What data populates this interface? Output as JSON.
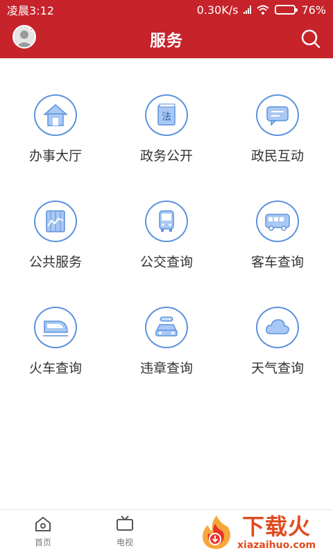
{
  "status_bar": {
    "time": "凌晨3:12",
    "network_speed": "0.30K/s",
    "battery": "76%",
    "battery_level": 0.76
  },
  "header": {
    "title": "服务"
  },
  "services": [
    {
      "label": "办事大厅",
      "icon": "house-icon"
    },
    {
      "label": "政务公开",
      "icon": "law-book-icon"
    },
    {
      "label": "政民互动",
      "icon": "chat-bubble-icon"
    },
    {
      "label": "公共服务",
      "icon": "chart-board-icon"
    },
    {
      "label": "公交查询",
      "icon": "bus-front-icon"
    },
    {
      "label": "客车查询",
      "icon": "coach-bus-icon"
    },
    {
      "label": "火车查询",
      "icon": "train-icon"
    },
    {
      "label": "违章查询",
      "icon": "car-violation-icon"
    },
    {
      "label": "天气查询",
      "icon": "cloud-icon"
    }
  ],
  "law_glyph": "法",
  "bottom_nav": [
    {
      "label": "首页",
      "icon": "home-icon"
    },
    {
      "label": "电视",
      "icon": "tv-icon"
    }
  ],
  "watermark": {
    "title": "下载火",
    "subtitle": "xiazaihuo.com"
  },
  "colors": {
    "brand_red": "#c6232b",
    "icon_blue": "#5b92dd",
    "icon_fill": "#a9c8f3"
  }
}
